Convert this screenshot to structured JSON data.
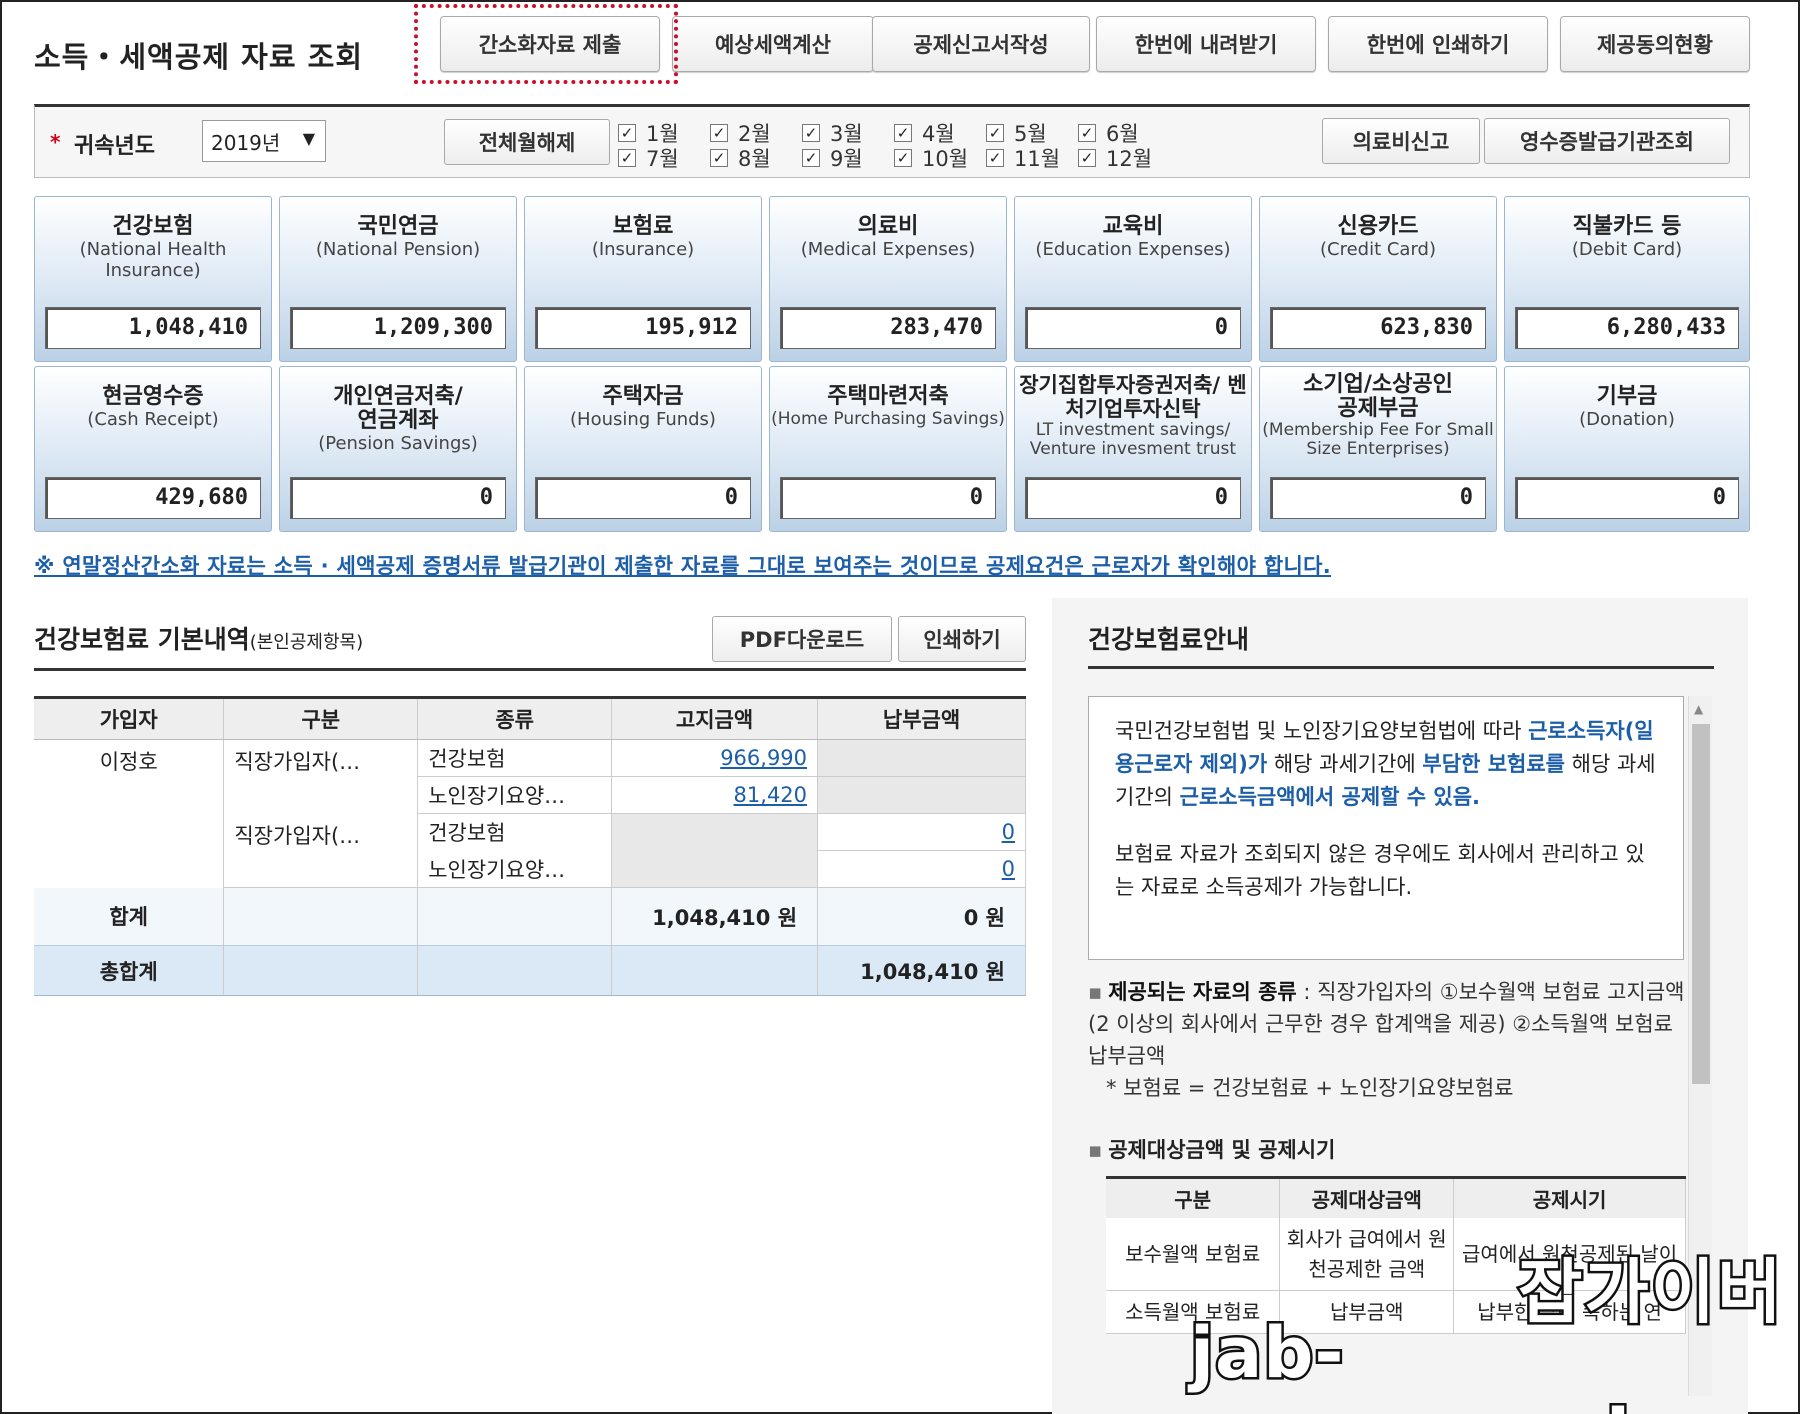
{
  "header": {
    "title": "소득・세액공제 자료 조회",
    "buttons": [
      "간소화자료 제출",
      "예상세액계산",
      "공제신고서작성",
      "한번에 내려받기",
      "한번에 인쇄하기",
      "제공동의현황"
    ]
  },
  "filter": {
    "required_mark": "*",
    "year_label": "귀속년도",
    "year_value": "2019년",
    "clear_months": "전체월해제",
    "months": [
      "1월",
      "2월",
      "3월",
      "4월",
      "5월",
      "6월",
      "7월",
      "8월",
      "9월",
      "10월",
      "11월",
      "12월"
    ],
    "months_checked": true,
    "medical_report": "의료비신고",
    "receipt_issuer": "영수증발급기관조회"
  },
  "cards": [
    {
      "ko": "건강보험",
      "en": "(National Health Insurance)",
      "value": "1,048,410"
    },
    {
      "ko": "국민연금",
      "en": "(National Pension)",
      "value": "1,209,300"
    },
    {
      "ko": "보험료",
      "en": "(Insurance)",
      "value": "195,912"
    },
    {
      "ko": "의료비",
      "en": "(Medical Expenses)",
      "value": "283,470"
    },
    {
      "ko": "교육비",
      "en": "(Education Expenses)",
      "value": "0"
    },
    {
      "ko": "신용카드",
      "en": "(Credit Card)",
      "value": "623,830"
    },
    {
      "ko": "직불카드 등",
      "en": "(Debit Card)",
      "value": "6,280,433"
    },
    {
      "ko": "현금영수증",
      "en": "(Cash Receipt)",
      "value": "429,680"
    },
    {
      "ko": "개인연금저축/ 연금계좌",
      "en": "(Pension Savings)",
      "value": "0"
    },
    {
      "ko": "주택자금",
      "en": "(Housing Funds)",
      "value": "0"
    },
    {
      "ko": "주택마련저축",
      "en": "(Home Purchasing Savings)",
      "value": "0"
    },
    {
      "ko": "장기집합투자증권저축/ 벤처기업투자신탁",
      "en": "LT investment savings/ Venture invesment trust",
      "value": "0"
    },
    {
      "ko": "소기업/소상공인 공제부금",
      "en": "(Membership Fee For Small Size Enterprises)",
      "value": "0"
    },
    {
      "ko": "기부금",
      "en": "(Donation)",
      "value": "0"
    }
  ],
  "notice": "※ 연말정산간소화 자료는 소득 · 세액공제 증명서류 발급기관이 제출한 자료를 그대로 보여주는 것이므로 공제요건은 근로자가 확인해야 합니다.",
  "left": {
    "title": "건강보험료 기본내역",
    "title_sub": "(본인공제항목)",
    "pdf_btn": "PDF다운로드",
    "print_btn": "인쇄하기",
    "columns": [
      "가입자",
      "구분",
      "종류",
      "고지금액",
      "납부금액"
    ],
    "subscriber": "이정호",
    "rows": [
      {
        "type": "직장가입자(…",
        "kind": "건강보험",
        "notice": "966,990",
        "paid": ""
      },
      {
        "type": "",
        "kind": "노인장기요양…",
        "notice": "81,420",
        "paid": ""
      },
      {
        "type": "직장가입자(…",
        "kind": "건강보험",
        "notice": "",
        "paid": "0"
      },
      {
        "type": "",
        "kind": "노인장기요양…",
        "notice": "",
        "paid": "0"
      }
    ],
    "sum_label": "합계",
    "sum_notice": "1,048,410 원",
    "sum_paid": "0 원",
    "total_label": "총합계",
    "total_value": "1,048,410 원"
  },
  "right": {
    "title": "건강보험료안내",
    "info_p1_a": "국민건강보험법 및 노인장기요양보험법에 따라 ",
    "info_p1_b": "근로소득자(일용근로자 제외)가",
    "info_p1_c": " 해당 과세기간에 ",
    "info_p1_d": "부담한 보험료를",
    "info_p1_e": " 해당 과세기간의 ",
    "info_p1_f": "근로소득금액에서 공제할 수 있음.",
    "info_p2": "보험료 자료가 조회되지 않은 경우에도 회사에서 관리하고 있는 자료로 소득공제가 가능합니다.",
    "provided_label": "제공되는 자료의 종류",
    "provided_text": " : 직장가입자의 ①보수월액 보험료 고지금액(2 이상의 회사에서 근무한 경우 합계액을 제공) ②소득월액 보험료 납부금액",
    "formula": "* 보험료 = 건강보험료 + 노인장기요양보험료",
    "deduct_title": "공제대상금액 및 공제시기",
    "deduct_cols": [
      "구분",
      "공제대상금액",
      "공제시기"
    ],
    "deduct_rows": [
      [
        "보수월액 보험료",
        "회사가 급여에서 원천공제한 금액",
        "급여에서 원천공제된 날이"
      ],
      [
        "소득월액 보험료",
        "납부금액",
        "납부한 날이 속하는 연"
      ]
    ]
  },
  "watermark": {
    "line1": "잡가이버",
    "line2": "jab-guyver.co.kr"
  },
  "colors": {
    "accent_blue": "#1c5ea8",
    "highlight_red": "#c8102e",
    "card_blue": "#bcd1e6"
  }
}
